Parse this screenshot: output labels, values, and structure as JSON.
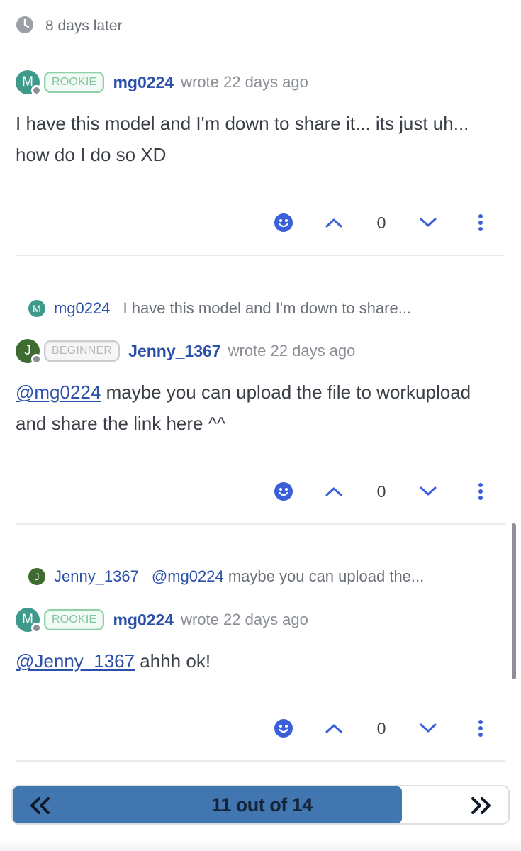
{
  "time_gap": {
    "label": "8 days later",
    "icon": "clock-icon"
  },
  "posts": [
    {
      "avatar_letter": "M",
      "avatar_color": "#3f9a8c",
      "badge": "ROOKIE",
      "username": "mg0224",
      "wrote": "wrote 22 days ago",
      "body_text": "I have this model and I'm down to share it... its just uh... how do I do so XD",
      "likes": "0"
    },
    {
      "reply_to": {
        "avatar_letter": "M",
        "avatar_color": "#3f9a8c",
        "username": "mg0224",
        "excerpt": "I have this model and I'm down to share..."
      },
      "avatar_letter": "J",
      "avatar_color": "#3e6b2f",
      "badge": "BEGINNER",
      "username": "Jenny_1367",
      "wrote": "wrote 22 days ago",
      "body_mention": "@mg0224",
      "body_text": " maybe you can upload the file to workupload and share the link here ^^",
      "likes": "0"
    },
    {
      "reply_to": {
        "avatar_letter": "J",
        "avatar_color": "#3e6b2f",
        "username": "Jenny_1367",
        "excerpt_mention": "@mg0224",
        "excerpt": " maybe you can upload the..."
      },
      "avatar_letter": "M",
      "avatar_color": "#3f9a8c",
      "badge": "ROOKIE",
      "username": "mg0224",
      "wrote": "wrote 22 days ago",
      "body_mention": "@Jenny_1367",
      "body_text": " ahhh ok!",
      "likes": "0"
    }
  ],
  "pager": {
    "label": "11 out of 14",
    "current": 11,
    "total": 14,
    "prev_icon": "double-chevron-left-icon",
    "next_icon": "double-chevron-right-icon"
  },
  "colors": {
    "accent": "#2b50aa",
    "icon_blue": "#3b5fd9",
    "pager_fill": "#4276b0"
  }
}
